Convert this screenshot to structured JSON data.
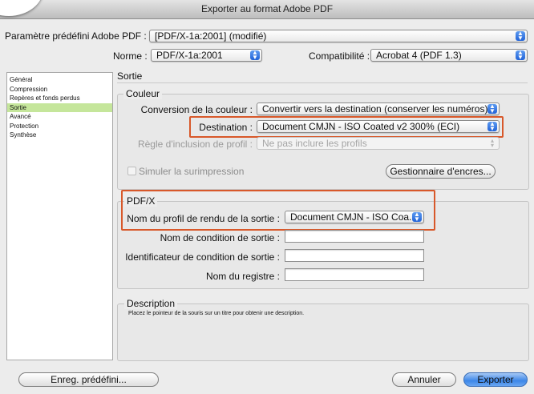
{
  "window": {
    "title": "Exporter au format Adobe PDF"
  },
  "preset": {
    "label": "Paramètre prédéfini Adobe PDF :",
    "value": "[PDF/X-1a:2001] (modifié)"
  },
  "norme": {
    "label": "Norme :",
    "value": "PDF/X-1a:2001"
  },
  "compat": {
    "label": "Compatibilité :",
    "value": "Acrobat 4 (PDF 1.3)"
  },
  "sidebar": {
    "items": [
      {
        "label": "Général",
        "selected": false
      },
      {
        "label": "Compression",
        "selected": false
      },
      {
        "label": "Repères et fonds perdus",
        "selected": false
      },
      {
        "label": "Sortie",
        "selected": true
      },
      {
        "label": "Avancé",
        "selected": false
      },
      {
        "label": "Protection",
        "selected": false
      },
      {
        "label": "Synthèse",
        "selected": false
      }
    ]
  },
  "section_title": "Sortie",
  "couleur": {
    "legend": "Couleur",
    "conversion_label": "Conversion de la couleur :",
    "conversion_value": "Convertir vers la destination (conserver les numéros)",
    "destination_label": "Destination :",
    "destination_value": "Document CMJN - ISO Coated v2 300% (ECI)",
    "profil_label": "Règle d'inclusion de profil :",
    "profil_value": "Ne pas inclure les profils",
    "simuler_label": "Simuler la surimpression",
    "gestionnaire_label": "Gestionnaire d'encres..."
  },
  "pdfx": {
    "legend": "PDF/X",
    "profil_label": "Nom du profil de rendu de la sortie :",
    "profil_value": "Document CMJN - ISO Coa...",
    "condition_label": "Nom de condition de sortie :",
    "condition_value": "",
    "identificateur_label": "Identificateur de condition de sortie :",
    "identificateur_value": "",
    "registre_label": "Nom du registre :",
    "registre_value": ""
  },
  "description": {
    "legend": "Description",
    "text": "Placez le pointeur de la souris sur un titre pour obtenir une description."
  },
  "buttons": {
    "save_preset": "Enreg. prédéfini...",
    "cancel": "Annuler",
    "export": "Exporter"
  },
  "colors": {
    "highlight": "#d8582a",
    "selected_item": "#c5e69b",
    "accent": "#2163d8"
  }
}
